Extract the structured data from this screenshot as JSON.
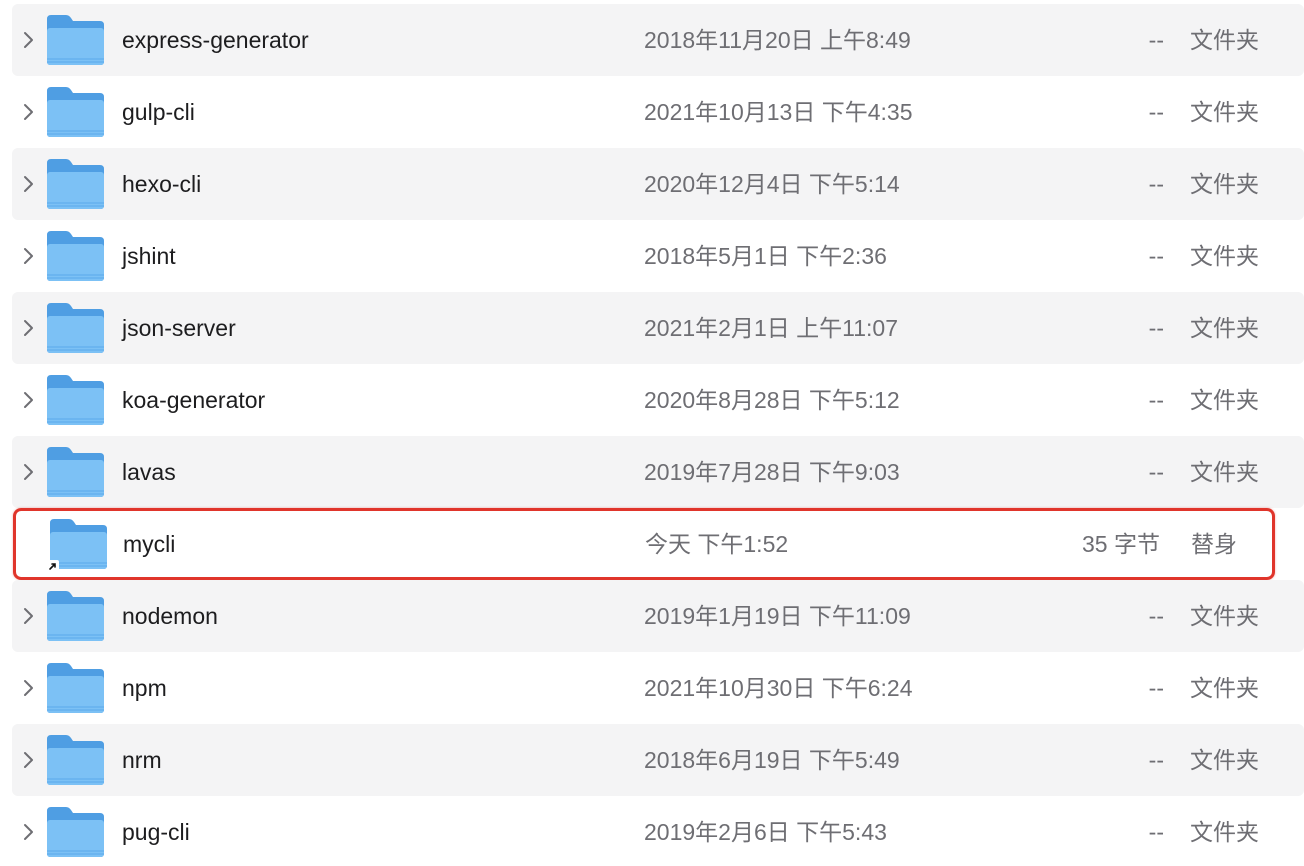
{
  "colors": {
    "row_stripe": "#f4f4f5",
    "folder_blue": "#7cc1f5",
    "highlight_border": "#e0352b"
  },
  "rows": [
    {
      "name": "express-generator",
      "date": "2018年11月20日 上午8:49",
      "size": "--",
      "kind": "文件夹",
      "icon": "folder-icon"
    },
    {
      "name": "gulp-cli",
      "date": "2021年10月13日 下午4:35",
      "size": "--",
      "kind": "文件夹",
      "icon": "folder-icon"
    },
    {
      "name": "hexo-cli",
      "date": "2020年12月4日 下午5:14",
      "size": "--",
      "kind": "文件夹",
      "icon": "folder-icon"
    },
    {
      "name": "jshint",
      "date": "2018年5月1日 下午2:36",
      "size": "--",
      "kind": "文件夹",
      "icon": "folder-icon"
    },
    {
      "name": "json-server",
      "date": "2021年2月1日 上午11:07",
      "size": "--",
      "kind": "文件夹",
      "icon": "folder-icon"
    },
    {
      "name": "koa-generator",
      "date": "2020年8月28日 下午5:12",
      "size": "--",
      "kind": "文件夹",
      "icon": "folder-icon"
    },
    {
      "name": "lavas",
      "date": "2019年7月28日 下午9:03",
      "size": "--",
      "kind": "文件夹",
      "icon": "folder-icon"
    },
    {
      "name": "mycli",
      "date": "今天 下午1:52",
      "size": "35 字节",
      "kind": "替身",
      "icon": "folder-alias-icon"
    },
    {
      "name": "nodemon",
      "date": "2019年1月19日 下午11:09",
      "size": "--",
      "kind": "文件夹",
      "icon": "folder-icon"
    },
    {
      "name": "npm",
      "date": "2021年10月30日 下午6:24",
      "size": "--",
      "kind": "文件夹",
      "icon": "folder-icon"
    },
    {
      "name": "nrm",
      "date": "2018年6月19日 下午5:49",
      "size": "--",
      "kind": "文件夹",
      "icon": "folder-icon"
    },
    {
      "name": "pug-cli",
      "date": "2019年2月6日 下午5:43",
      "size": "--",
      "kind": "文件夹",
      "icon": "folder-icon"
    }
  ]
}
